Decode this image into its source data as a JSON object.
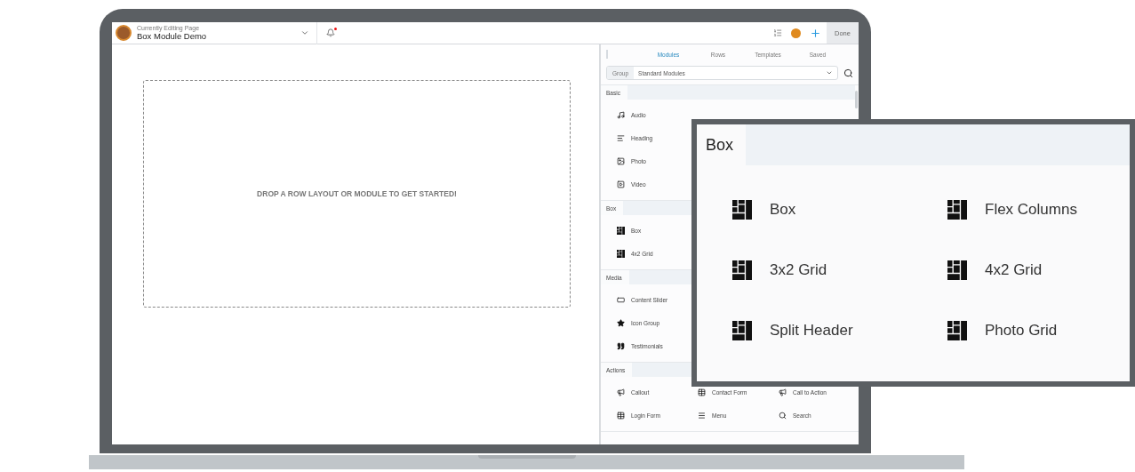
{
  "top_bar": {
    "subtitle": "Currently Editing Page",
    "title": "Box Module Demo",
    "notification": true,
    "done_button": "Done"
  },
  "canvas": {
    "message": "DROP A ROW LAYOUT OR MODULE TO GET STARTED!"
  },
  "panel": {
    "tabs": [
      {
        "label": "Modules",
        "selected": true
      },
      {
        "label": "Rows",
        "selected": false
      },
      {
        "label": "Templates",
        "selected": false
      },
      {
        "label": "Saved",
        "selected": false
      }
    ],
    "group": {
      "label": "Group",
      "value": "Standard Modules"
    },
    "sections": [
      {
        "title": "Basic",
        "kind": "list",
        "items": [
          {
            "label": "Audio",
            "kind": "music"
          },
          {
            "label": "Heading",
            "kind": "heading"
          },
          {
            "label": "Photo",
            "kind": "photo"
          },
          {
            "label": "Video",
            "kind": "video"
          }
        ]
      },
      {
        "title": "Box",
        "kind": "list",
        "items": [
          {
            "label": "Box",
            "kind": "box"
          },
          {
            "label": "4x2 Grid",
            "kind": "box"
          }
        ]
      },
      {
        "title": "Media",
        "kind": "list",
        "items": [
          {
            "label": "Content Slider",
            "kind": "slider"
          },
          {
            "label": "Icon Group",
            "kind": "star"
          },
          {
            "label": "Testimonials",
            "kind": "quote"
          }
        ]
      },
      {
        "title": "Actions",
        "kind": "grid",
        "items": [
          {
            "label": "Callout",
            "kind": "megaphone"
          },
          {
            "label": "Contact Form",
            "kind": "table"
          },
          {
            "label": "Call to Action",
            "kind": "megaphone"
          },
          {
            "label": "Login Form",
            "kind": "table"
          },
          {
            "label": "Menu",
            "kind": "menu"
          },
          {
            "label": "Search",
            "kind": "search"
          }
        ]
      }
    ]
  },
  "inset": {
    "title": "Box",
    "items": [
      {
        "label": "Box",
        "kind": "box"
      },
      {
        "label": "Flex Columns",
        "kind": "box"
      },
      {
        "label": "3x2 Grid",
        "kind": "box"
      },
      {
        "label": "4x2 Grid",
        "kind": "box"
      },
      {
        "label": "Split Header",
        "kind": "box"
      },
      {
        "label": "Photo Grid",
        "kind": "box"
      }
    ]
  }
}
